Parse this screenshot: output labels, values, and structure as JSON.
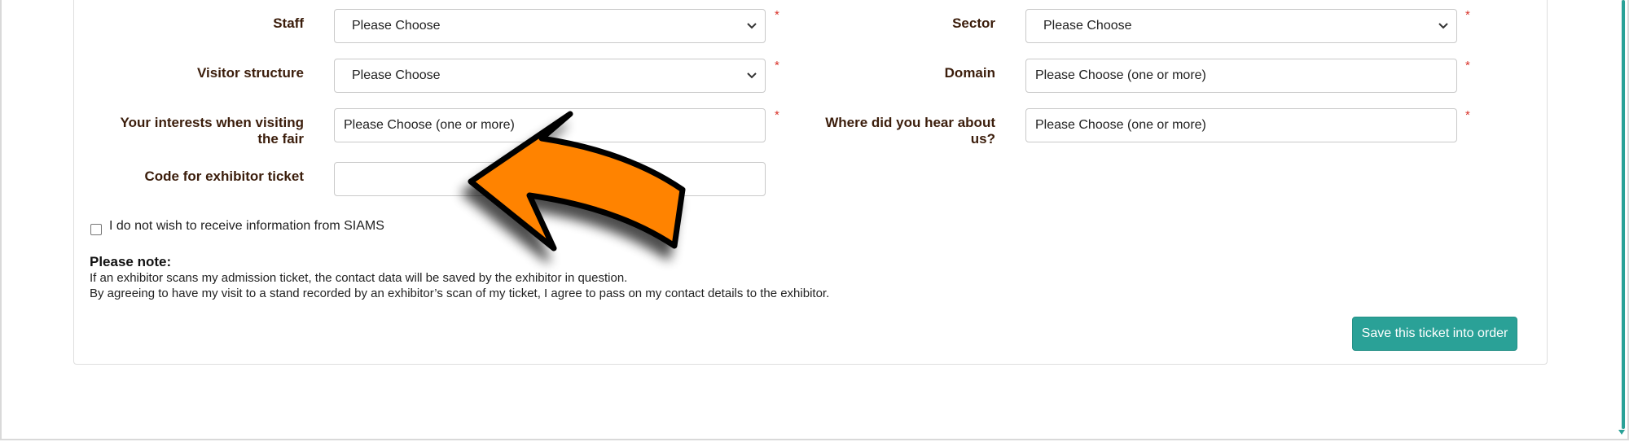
{
  "form": {
    "staff": {
      "label": "Staff",
      "value": "Please Choose",
      "required_mark": "*"
    },
    "sector": {
      "label": "Sector",
      "value": "Please Choose",
      "required_mark": "*"
    },
    "visitor_structure": {
      "label": "Visitor structure",
      "value": "Please Choose",
      "required_mark": "*"
    },
    "domain": {
      "label": "Domain",
      "value": "Please Choose (one or more)",
      "required_mark": "*"
    },
    "interests": {
      "label_line1": "Your interests when visiting",
      "label_line2": "the fair",
      "value": "Please Choose (one or more)",
      "required_mark": "*"
    },
    "hear_about": {
      "label_line1": "Where did you hear about",
      "label_line2": "us?",
      "value": "Please Choose (one or more)",
      "required_mark": "*"
    },
    "exhibitor_code": {
      "label": "Code for exhibitor ticket",
      "value": ""
    }
  },
  "opt_out": {
    "label": "I do not wish to receive information from SIAMS",
    "checked": false
  },
  "note": {
    "title": "Please note:",
    "line1": "If an exhibitor scans my admission ticket, the contact data will be saved by the exhibitor in question.",
    "line2": "By agreeing to have my visit to a stand recorded by an exhibitor’s scan of my ticket, I agree to pass on my contact details to the exhibitor."
  },
  "actions": {
    "save_label": "Save this ticket into order"
  },
  "icons": {
    "dropdown": "chevron-down-icon",
    "annotation": "orange-arrow-icon"
  },
  "colors": {
    "accent": "#2aa197",
    "label": "#3b1d0b",
    "required": "#d9342b",
    "arrow": "#ff8300"
  }
}
